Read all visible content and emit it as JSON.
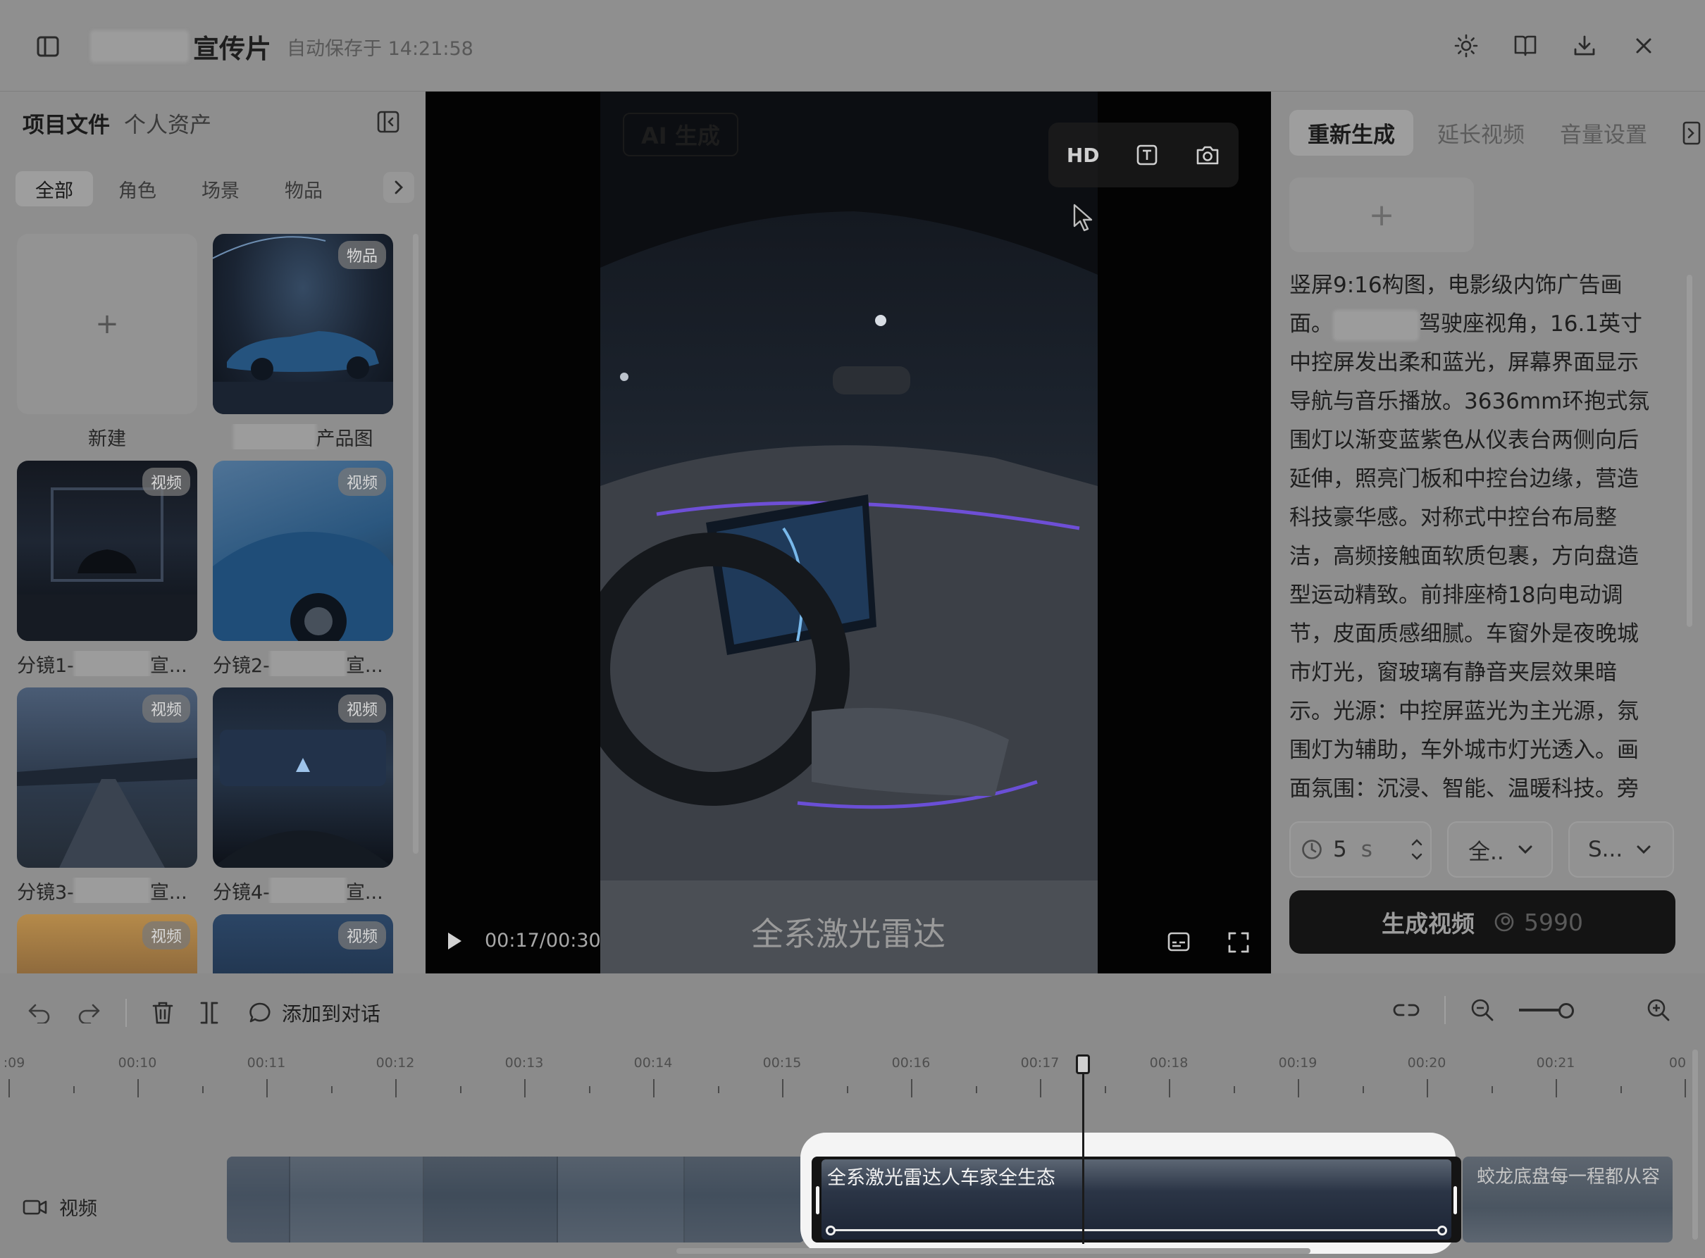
{
  "header": {
    "title": "宣传片",
    "autosave": "自动保存于 14:21:58"
  },
  "left_panel": {
    "tabs": [
      "项目文件",
      "个人资产"
    ],
    "categories": [
      "全部",
      "角色",
      "场景",
      "物品"
    ],
    "assets": [
      {
        "name": "新建",
        "badge": ""
      },
      {
        "name": "产品图",
        "badge": "物品"
      },
      {
        "name": "分镜1-",
        "suffix": "宣...",
        "badge": "视频"
      },
      {
        "name": "分镜2-",
        "suffix": "宣...",
        "badge": "视频"
      },
      {
        "name": "分镜3-",
        "suffix": "宣...",
        "badge": "视频"
      },
      {
        "name": "分镜4-",
        "suffix": "宣...",
        "badge": "视频"
      },
      {
        "name": "",
        "badge": "视频"
      },
      {
        "name": "",
        "badge": "视频"
      }
    ],
    "new_plus": "+"
  },
  "preview": {
    "ai_badge": "AI 生成",
    "hd_label": "HD",
    "subtitle": "全系激光雷达",
    "timecode": "00:17/00:30"
  },
  "right_panel": {
    "tabs": [
      "重新生成",
      "延长视频",
      "音量设置"
    ],
    "add_plus": "+",
    "prompt_start": "竖屏9:16构图，电影级内饰广告画面。",
    "prompt_rest": "驾驶座视角，16.1英寸中控屏发出柔和蓝光，屏幕界面显示导航与音乐播放。3636mm环抱式氛围灯以渐变蓝紫色从仪表台两侧向后延伸，照亮门板和中控台边缘，营造科技豪华感。对称式中控台布局整洁，高频接触面软质包裹，方向盘造型运动精致。前排座椅18向电动调节，皮面质感细腻。车窗外是夜晚城市灯光，窗玻璃有静音夹层效果暗示。光源：中控屏蓝光为主光源，氛围灯为辅助，车外城市灯光透入。画面氛围：沉浸、智能、温暖科技。旁",
    "duration_value": "5",
    "duration_unit": "s",
    "select_1": "全..",
    "select_2": "S...",
    "generate_label": "生成视频",
    "generate_cost": "5990"
  },
  "timeline": {
    "add_to_chat": "添加到对话",
    "ruler_labels": [
      ":09",
      "00:10",
      "00:11",
      "00:12",
      "00:13",
      "00:14",
      "00:15",
      "00:16",
      "00:17",
      "00:18",
      "00:19",
      "00:20",
      "00:21",
      "00"
    ],
    "track_label": "视频",
    "clips": [
      {
        "title": ""
      },
      {
        "title": "全系激光雷达人车家全生态"
      },
      {
        "title": "蛟龙底盘每一程都从容"
      }
    ]
  }
}
